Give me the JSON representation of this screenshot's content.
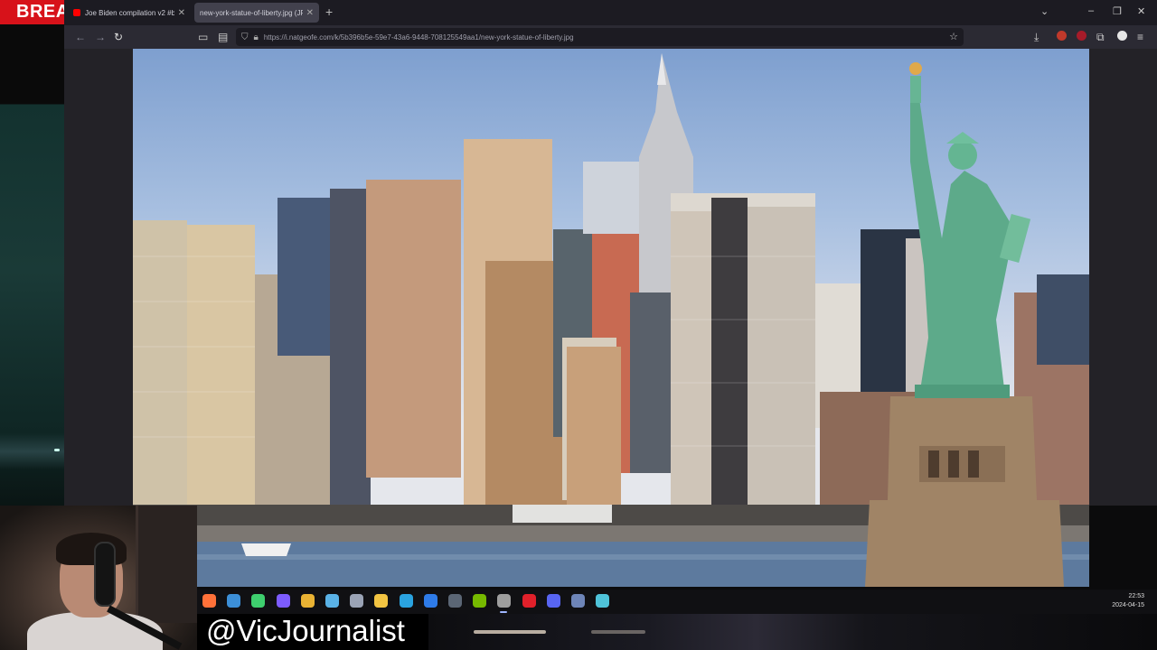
{
  "overlay": {
    "breaking_text": "BREA",
    "handle": "@VicJournalist"
  },
  "browser": {
    "tabs": [
      {
        "title": "Joe Biden compilation v2 #bide",
        "favicon": "youtube-icon",
        "active": false
      },
      {
        "title": "new-york-statue-of-liberty.jpg (JP",
        "favicon": "image-icon",
        "active": true
      }
    ],
    "url": "https://i.natgeofe.com/k/5b396b5e-59e7-43a6-9448-708125549aa1/new-york-statue-of-liberty.jpg",
    "new_tab_label": "+",
    "window_controls": [
      "chevron-down-icon",
      "minimize-icon",
      "restore-icon",
      "close-icon"
    ]
  },
  "taskbar": {
    "time": "22:53",
    "date": "2024-04-15",
    "apps": [
      {
        "name": "firefox-icon",
        "color": "#ff7139"
      },
      {
        "name": "edge-icon",
        "color": "#3c8fd8"
      },
      {
        "name": "app-hex-icon",
        "color": "#3ecf6e"
      },
      {
        "name": "app-infinity-icon",
        "color": "#7d5cff"
      },
      {
        "name": "chrome-icon",
        "color": "#e9b233"
      },
      {
        "name": "monitor-icon",
        "color": "#5ab2e6"
      },
      {
        "name": "settings-icon",
        "color": "#9aa3b5"
      },
      {
        "name": "folder-icon",
        "color": "#f2c442"
      },
      {
        "name": "telegram-icon",
        "color": "#2aa3e0"
      },
      {
        "name": "firefox-blue-icon",
        "color": "#2e7be8"
      },
      {
        "name": "steam-icon",
        "color": "#5b6675"
      },
      {
        "name": "nvidia-icon",
        "color": "#76b900"
      },
      {
        "name": "obs-icon",
        "color": "#9e9e9e"
      },
      {
        "name": "opera-icon",
        "color": "#e0202a"
      },
      {
        "name": "discord-icon",
        "color": "#5865f2"
      },
      {
        "name": "calculator-icon",
        "color": "#6e85b8"
      },
      {
        "name": "notepad-icon",
        "color": "#4fc3d9"
      }
    ]
  }
}
